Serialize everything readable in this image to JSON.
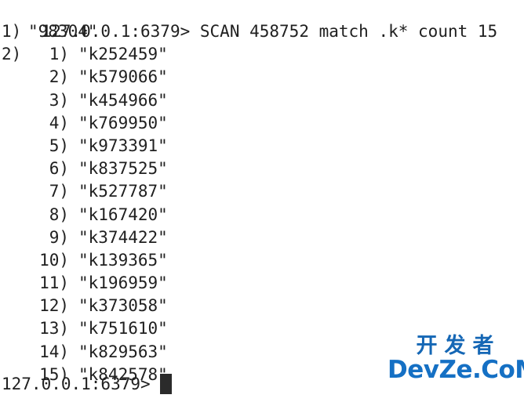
{
  "terminal": {
    "background_color": "#ffffff",
    "text_color": "#202020",
    "cursor_color": "#2b2b2b",
    "command_line": {
      "prompt": "127.0.0.1:6379>",
      "separator": " ",
      "command": "SCAN 458752 match .k* count 15",
      "full_text": "127.0.0.1:6379> SCAN 458752 match .k* count 15"
    },
    "reply": {
      "rows": [
        {
          "index": "1)",
          "value": "\"98304\"",
          "nested": false
        },
        {
          "index": "2)",
          "value": "",
          "nested": true,
          "items": [
            {
              "index": "1)",
              "value": "\"k252459\""
            },
            {
              "index": "2)",
              "value": "\"k579066\""
            },
            {
              "index": "3)",
              "value": "\"k454966\""
            },
            {
              "index": "4)",
              "value": "\"k769950\""
            },
            {
              "index": "5)",
              "value": "\"k973391\""
            },
            {
              "index": "6)",
              "value": "\"k837525\""
            },
            {
              "index": "7)",
              "value": "\"k527787\""
            },
            {
              "index": "8)",
              "value": "\"k167420\""
            },
            {
              "index": "9)",
              "value": "\"k374422\""
            },
            {
              "index": "10)",
              "value": "\"k139365\""
            },
            {
              "index": "11)",
              "value": "\"k196959\""
            },
            {
              "index": "12)",
              "value": "\"k373058\""
            },
            {
              "index": "13)",
              "value": "\"k751610\""
            },
            {
              "index": "14)",
              "value": "\"k829563\""
            },
            {
              "index": "15)",
              "value": "\"k842578\""
            }
          ]
        }
      ]
    },
    "bottom_prompt": {
      "prompt": "127.0.0.1:6379>",
      "input_value": "",
      "cursor_visible": true
    }
  },
  "watermark": {
    "chinese_text": "开发者",
    "latin_text": "DevZe.CoM",
    "color_chinese": "#1567b5",
    "color_latin": "#1570c4"
  }
}
